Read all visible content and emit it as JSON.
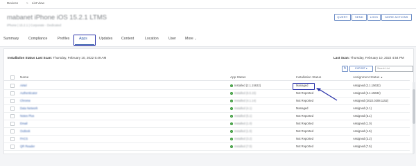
{
  "breadcrumb": {
    "root": "Devices",
    "separator": ">",
    "current": "List View"
  },
  "device": {
    "title": "mabanet iPhone iOS 15.2.1 LTMS",
    "subtitle": "iPhone  |  15.2.1  |  Corporate - Dedicated"
  },
  "header_buttons": [
    "QUERY",
    "SEND",
    "LOCK",
    "MORE ACTIONS"
  ],
  "tabs": [
    {
      "label": "Summary",
      "active": false
    },
    {
      "label": "Compliance",
      "active": false
    },
    {
      "label": "Profiles",
      "active": false
    },
    {
      "label": "Apps",
      "active": true
    },
    {
      "label": "Updates",
      "active": false
    },
    {
      "label": "Content",
      "active": false
    },
    {
      "label": "Location",
      "active": false
    },
    {
      "label": "User",
      "active": false
    },
    {
      "label": "More",
      "active": false
    }
  ],
  "scan": {
    "left_label": "Installation Status Last Scan:",
    "left_value": "Thursday, February 10, 2022 5:49 AM",
    "right_label": "Last Scan:",
    "right_value": "Thursday, February 10, 2022 4:54 PM"
  },
  "toolbar": {
    "export_label": "EXPORT",
    "search_placeholder": "Search List"
  },
  "table": {
    "headers": {
      "name": "Name",
      "app_status": "App Status",
      "installation_status": "Installation Status",
      "assignment_status": "Assignment Status"
    },
    "rows": [
      {
        "name": "Airtel",
        "app_ok": true,
        "app_status": "Installed (2.1.15632)",
        "installation_status": "Managed",
        "assignment_status": "Assigned (2.1.15632)"
      },
      {
        "name": "Authenticator",
        "app_ok": true,
        "app_status": "Installed (6.5.15)",
        "installation_status": "Not Reported",
        "assignment_status": "Assigned (2.1.15632)"
      },
      {
        "name": "Chrome",
        "app_ok": true,
        "app_status": "Installed (4.1.14)",
        "installation_status": "Not Reported",
        "assignment_status": "Assigned (2022.0208.1152)"
      },
      {
        "name": "Data Network",
        "app_ok": true,
        "app_status": "Installed (4.1)",
        "installation_status": "Managed",
        "assignment_status": "Assigned (4.1)"
      },
      {
        "name": "Notes Plus",
        "app_ok": true,
        "app_status": "Installed (5.1)",
        "installation_status": "Not Reported",
        "assignment_status": "Assigned (5.1)"
      },
      {
        "name": "Email",
        "app_ok": true,
        "app_status": "Installed (1.0)",
        "installation_status": "Not Reported",
        "assignment_status": "Assigned (1.0)"
      },
      {
        "name": "Outlook",
        "app_ok": true,
        "app_status": "Installed (1.5)",
        "installation_status": "Not Reported",
        "assignment_status": "Assigned (1.5)"
      },
      {
        "name": "PACS",
        "app_ok": true,
        "app_status": "Installed (3.2)",
        "installation_status": "Not Reported",
        "assignment_status": "Assigned (3.2)"
      },
      {
        "name": "QR Reader",
        "app_ok": true,
        "app_status": "Installed (7.5)",
        "installation_status": "Not Reported",
        "assignment_status": "Assigned (7.5)"
      }
    ]
  },
  "colors": {
    "accent": "#2f5aa8",
    "annotation": "#2730a8",
    "success": "#3a9a3a"
  }
}
